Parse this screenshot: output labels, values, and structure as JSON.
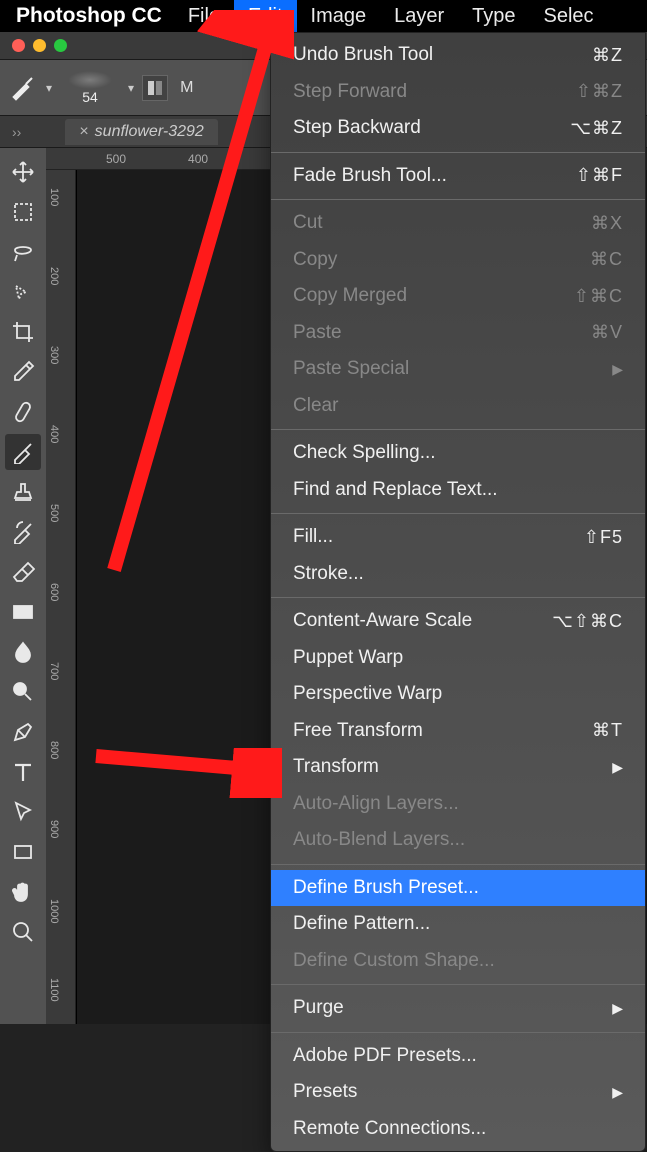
{
  "app": {
    "name": "Photoshop CC"
  },
  "menubar": {
    "items": [
      "File",
      "Edit",
      "Image",
      "Layer",
      "Type",
      "Selec"
    ],
    "active_index": 1
  },
  "optionsbar": {
    "brush_size": "54",
    "mode_label": "M"
  },
  "document": {
    "tab_title": "sunflower-3292"
  },
  "ruler": {
    "top_ticks": [
      "500",
      "400"
    ],
    "side_ticks": [
      "100",
      "200",
      "300",
      "400",
      "500",
      "600",
      "700",
      "800",
      "900",
      "1000",
      "1100"
    ]
  },
  "tools": [
    {
      "name": "move"
    },
    {
      "name": "marquee"
    },
    {
      "name": "lasso"
    },
    {
      "name": "quick-select"
    },
    {
      "name": "crop"
    },
    {
      "name": "eyedropper"
    },
    {
      "name": "healing"
    },
    {
      "name": "brush"
    },
    {
      "name": "stamp"
    },
    {
      "name": "history-brush"
    },
    {
      "name": "eraser"
    },
    {
      "name": "gradient"
    },
    {
      "name": "blur"
    },
    {
      "name": "dodge"
    },
    {
      "name": "pen"
    },
    {
      "name": "type"
    },
    {
      "name": "path-select"
    },
    {
      "name": "rectangle"
    },
    {
      "name": "hand"
    },
    {
      "name": "zoom"
    }
  ],
  "active_tool_index": 7,
  "menu": {
    "items": [
      {
        "label": "Undo Brush Tool",
        "shortcut": "⌘Z",
        "enabled": true
      },
      {
        "label": "Step Forward",
        "shortcut": "⇧⌘Z",
        "enabled": false
      },
      {
        "label": "Step Backward",
        "shortcut": "⌥⌘Z",
        "enabled": true
      },
      {
        "sep": true
      },
      {
        "label": "Fade Brush Tool...",
        "shortcut": "⇧⌘F",
        "enabled": true
      },
      {
        "sep": true
      },
      {
        "label": "Cut",
        "shortcut": "⌘X",
        "enabled": false
      },
      {
        "label": "Copy",
        "shortcut": "⌘C",
        "enabled": false
      },
      {
        "label": "Copy Merged",
        "shortcut": "⇧⌘C",
        "enabled": false
      },
      {
        "label": "Paste",
        "shortcut": "⌘V",
        "enabled": false
      },
      {
        "label": "Paste Special",
        "submenu": true,
        "enabled": false
      },
      {
        "label": "Clear",
        "enabled": false
      },
      {
        "sep": true
      },
      {
        "label": "Check Spelling...",
        "enabled": true
      },
      {
        "label": "Find and Replace Text...",
        "enabled": true
      },
      {
        "sep": true
      },
      {
        "label": "Fill...",
        "shortcut": "⇧F5",
        "enabled": true
      },
      {
        "label": "Stroke...",
        "enabled": true
      },
      {
        "sep": true
      },
      {
        "label": "Content-Aware Scale",
        "shortcut": "⌥⇧⌘C",
        "enabled": true
      },
      {
        "label": "Puppet Warp",
        "enabled": true
      },
      {
        "label": "Perspective Warp",
        "enabled": true
      },
      {
        "label": "Free Transform",
        "shortcut": "⌘T",
        "enabled": true
      },
      {
        "label": "Transform",
        "submenu": true,
        "enabled": true
      },
      {
        "label": "Auto-Align Layers...",
        "enabled": false
      },
      {
        "label": "Auto-Blend Layers...",
        "enabled": false
      },
      {
        "sep": true
      },
      {
        "label": "Define Brush Preset...",
        "enabled": true,
        "selected": true
      },
      {
        "label": "Define Pattern...",
        "enabled": true
      },
      {
        "label": "Define Custom Shape...",
        "enabled": false
      },
      {
        "sep": true
      },
      {
        "label": "Purge",
        "submenu": true,
        "enabled": true
      },
      {
        "sep": true
      },
      {
        "label": "Adobe PDF Presets...",
        "enabled": true
      },
      {
        "label": "Presets",
        "submenu": true,
        "enabled": true
      },
      {
        "label": "Remote Connections...",
        "enabled": true
      }
    ]
  }
}
